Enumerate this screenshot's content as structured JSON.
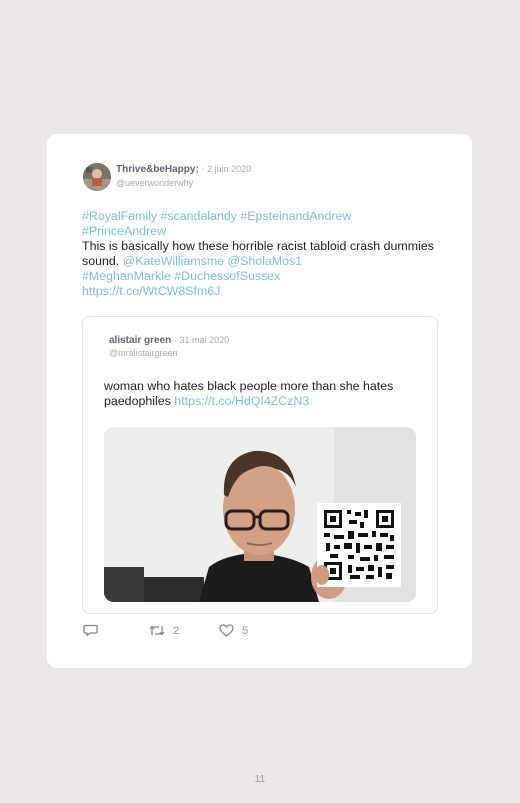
{
  "tweet": {
    "author_name": "Thrive&beHappy;",
    "date": "· 2 juin 2020",
    "handle": "@ueverwonderwhy",
    "hashtags_line1": "#RoyalFamily #scandalandy #EpsteinandAndrew",
    "hashtags_line2": "#PrinceAndrew",
    "text": "This is basically how these horrible racist tabloid crash dummies sound.",
    "mentions": "@KateWilliamsme @SholaMos1",
    "hashtags_line3": "#MeghanMarkle #DuchessofSussex",
    "link": "https://t.co/WtCW8Sfm6J"
  },
  "quoted_tweet": {
    "author_name": "alistair green",
    "date": "· 31 mai 2020",
    "handle": "@mralistairgreen",
    "text": "woman who hates black people more than she hates paedophiles",
    "link": "https://t.co/HdQI4ZCzN3"
  },
  "actions": {
    "reply_icon": "reply-icon",
    "retweet_icon": "retweet-icon",
    "retweet_count": "2",
    "like_icon": "heart-icon",
    "like_count": "5"
  },
  "page_number": "11",
  "colors": {
    "link": "#7cbde8",
    "page_background": "#ece7e7",
    "card_background": "#ffffff"
  }
}
